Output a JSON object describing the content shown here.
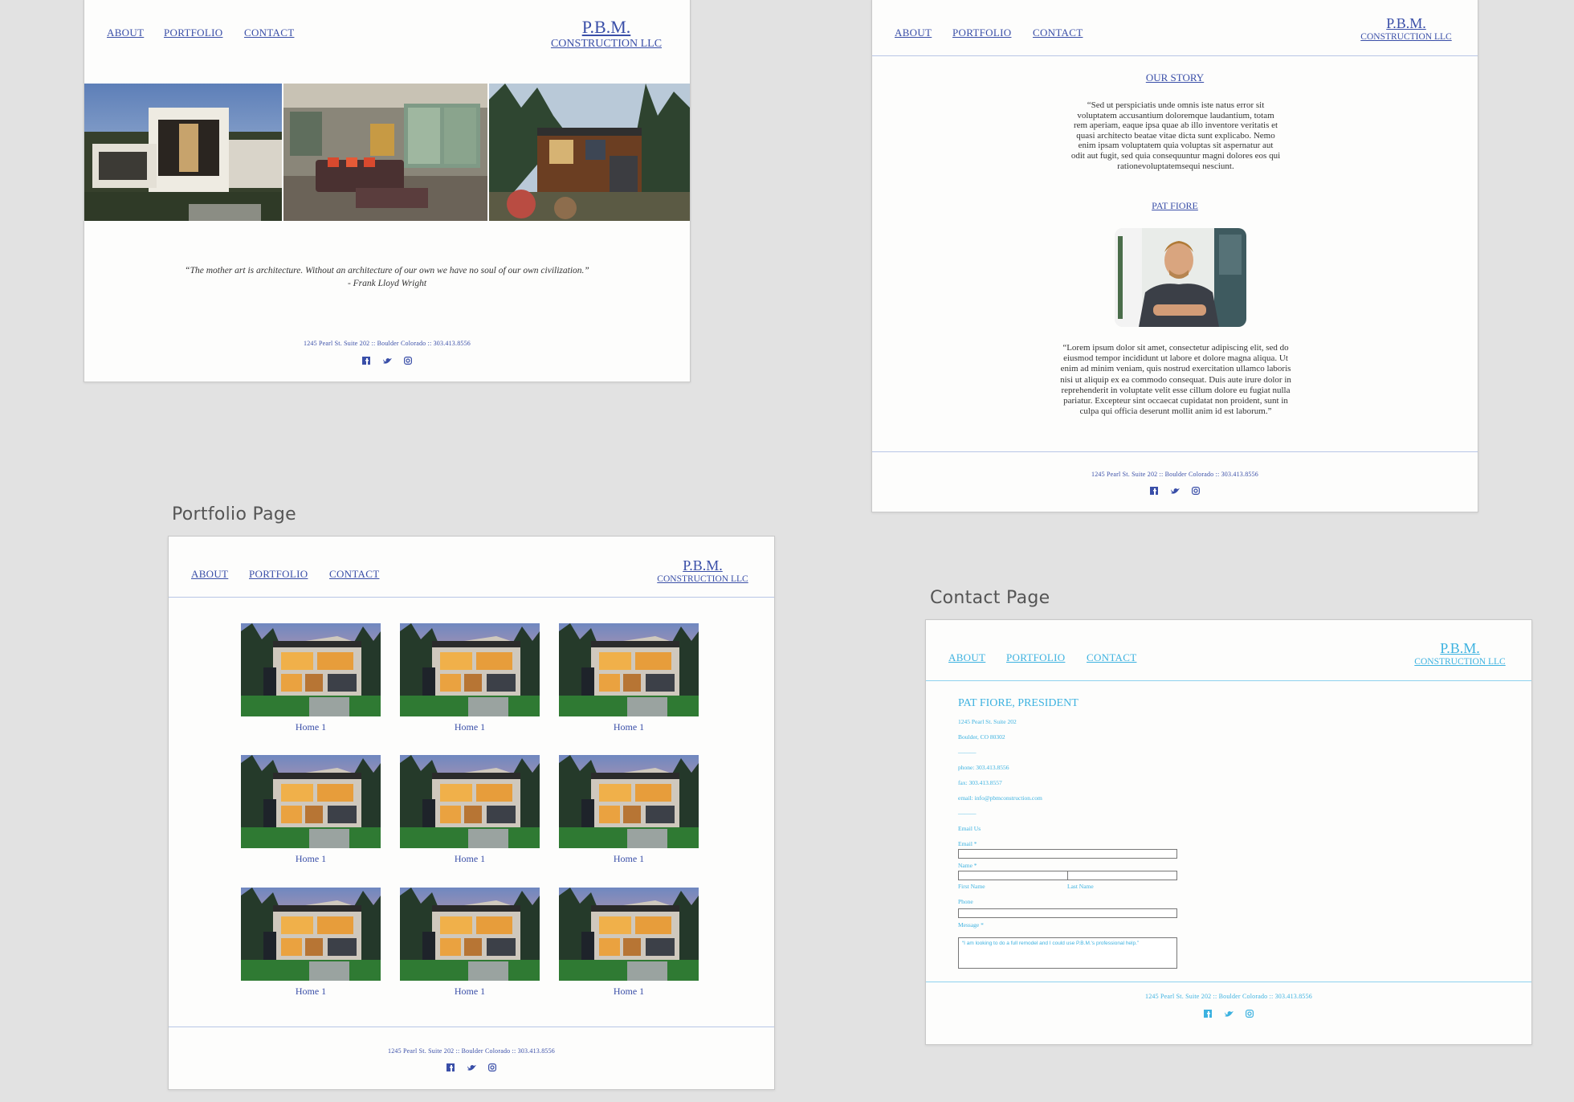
{
  "nav": {
    "about": "ABOUT",
    "portfolio": "PORTFOLIO",
    "contact": "CONTACT"
  },
  "logo": {
    "line1": "P.B.M.",
    "line2": "CONSTRUCTION LLC"
  },
  "footer": {
    "address": "1245 Pearl St. Suite 202  ::  Boulder Colorado  ::  303.413.8556"
  },
  "social_icons": [
    "facebook-icon",
    "twitter-icon",
    "instagram-icon"
  ],
  "colors": {
    "link_blue": "#3a4fa8",
    "contact_cyan": "#3db2e0",
    "divider": "#b8c6e6",
    "canvas": "#e2e2e2"
  },
  "home": {
    "quote": "“The mother art is architecture. Without an architecture of our own we have no soul of our own civilization.”",
    "quote_author": "- Frank Lloyd Wright"
  },
  "about": {
    "story_heading": "OUR STORY",
    "story_text": "“Sed ut perspiciatis unde omnis iste natus error sit voluptatem accusantium doloremque laudantium, totam rem aperiam, eaque ipsa quae ab illo inventore veritatis et quasi architecto beatae vitae dicta sunt explicabo. Nemo enim ipsam voluptatem quia voluptas sit aspernatur aut odit aut fugit, sed quia consequuntur magni dolores eos qui rationevoluptatemsequi nesciunt.",
    "person_heading": "PAT FIORE",
    "bio_text": "“Lorem ipsum dolor sit amet, consectetur adipiscing elit, sed do eiusmod tempor incididunt ut labore et dolore magna aliqua. Ut enim ad minim veniam, quis nostrud exercitation ullamco laboris nisi ut aliquip ex ea commodo consequat. Duis aute irure dolor in reprehenderit in voluptate velit esse cillum dolore eu fugiat nulla pariatur. Excepteur sint occaecat cupidatat non proident, sunt in culpa qui officia deserunt mollit anim id est laborum.”"
  },
  "portfolio": {
    "label": "Portfolio Page",
    "items": [
      "Home 1",
      "Home 1",
      "Home 1",
      "Home 1",
      "Home 1",
      "Home 1",
      "Home 1",
      "Home 1",
      "Home 1"
    ]
  },
  "contact": {
    "label": "Contact Page",
    "heading": "PAT FIORE, PRESIDENT",
    "address1": "1245 Pearl St. Suite 202",
    "address2": "Boulder, CO 80302",
    "divider": "———",
    "phone": "phone: 303.413.8556",
    "fax": "fax: 303.413.8557",
    "email": "email: info@pbmconstruction.com",
    "email_us": "Email Us",
    "email_label": "Email *",
    "name_label": "Name *",
    "first_name": "First Name",
    "last_name": "Last Name",
    "phone_label": "Phone",
    "message_label": "Message *",
    "message_text": "“I am looking to do a full remodel and I could use P.B.M.'s professional help.”"
  }
}
